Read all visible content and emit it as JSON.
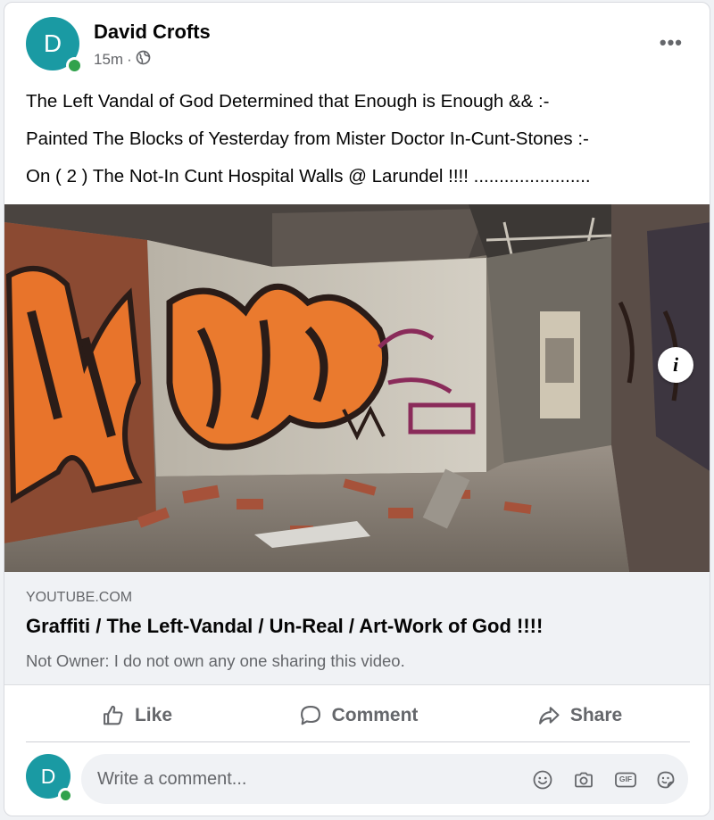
{
  "post": {
    "author": "David Crofts",
    "avatar_letter": "D",
    "time": "15m",
    "separator": "·",
    "audience_icon": "globe-icon",
    "text_lines": [
      "The Left Vandal of God Determined that Enough is Enough && :-",
      "Painted The Blocks of Yesterday from Mister Doctor In-Cunt-Stones :-",
      "On ( 2 ) The Not-In Cunt Hospital Walls @ Larundel !!!! ......................."
    ],
    "more_icon": "•••"
  },
  "media": {
    "info_label": "i"
  },
  "link_preview": {
    "domain": "YOUTUBE.COM",
    "title": "Graffiti / The Left-Vandal / Un-Real / Art-Work of God !!!!",
    "description": "Not Owner: I do not own any one sharing this video."
  },
  "actions": {
    "like": "Like",
    "comment": "Comment",
    "share": "Share"
  },
  "composer": {
    "avatar_letter": "D",
    "placeholder": "Write a comment...",
    "icons": [
      "emoji-icon",
      "camera-icon",
      "gif-icon",
      "sticker-icon"
    ],
    "gif_label": "GIF"
  },
  "colors": {
    "avatar": "#1a9aa3",
    "online": "#31a24c",
    "muted_text": "#65676b",
    "link_bg": "#f0f2f5"
  }
}
